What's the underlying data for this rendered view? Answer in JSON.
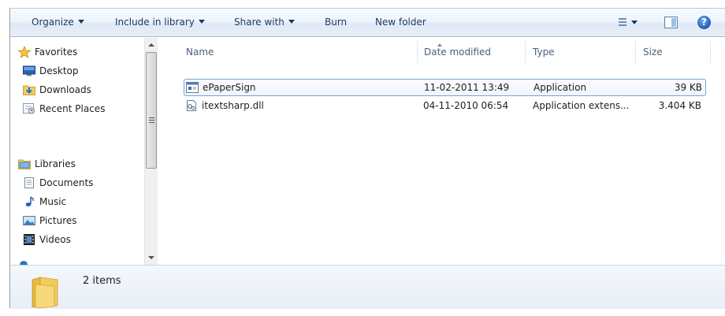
{
  "toolbar": {
    "organize_label": "Organize",
    "include_label": "Include in library",
    "share_label": "Share with",
    "burn_label": "Burn",
    "newfolder_label": "New folder",
    "views_icon": "views-icon",
    "preview_icon": "preview-pane-icon",
    "help_icon": "help-icon",
    "help_glyph": "?"
  },
  "nav": {
    "favorites": {
      "label": "Favorites",
      "icon": "star-icon",
      "items": [
        {
          "label": "Desktop",
          "icon": "desktop-icon"
        },
        {
          "label": "Downloads",
          "icon": "downloads-icon"
        },
        {
          "label": "Recent Places",
          "icon": "recent-places-icon"
        }
      ]
    },
    "libraries": {
      "label": "Libraries",
      "icon": "libraries-icon",
      "items": [
        {
          "label": "Documents",
          "icon": "documents-icon"
        },
        {
          "label": "Music",
          "icon": "music-icon"
        },
        {
          "label": "Pictures",
          "icon": "pictures-icon"
        },
        {
          "label": "Videos",
          "icon": "videos-icon"
        }
      ]
    }
  },
  "columns": {
    "name": "Name",
    "date": "Date modified",
    "type": "Type",
    "size": "Size"
  },
  "files": [
    {
      "name": "ePaperSign",
      "date": "11-02-2011 13:49",
      "type": "Application",
      "size": "39 KB",
      "icon": "application-icon",
      "selected": true
    },
    {
      "name": "itextsharp.dll",
      "date": "04-11-2010 06:54",
      "type": "Application extens...",
      "size": "3.404 KB",
      "icon": "dll-icon",
      "selected": false
    }
  ],
  "status": {
    "count": "2 items",
    "icon": "folder-icon"
  },
  "colors": {
    "toolbar_text": "#1e395b",
    "selection_border": "#7da2ce",
    "folder_yellow": "#f2cd5c"
  }
}
